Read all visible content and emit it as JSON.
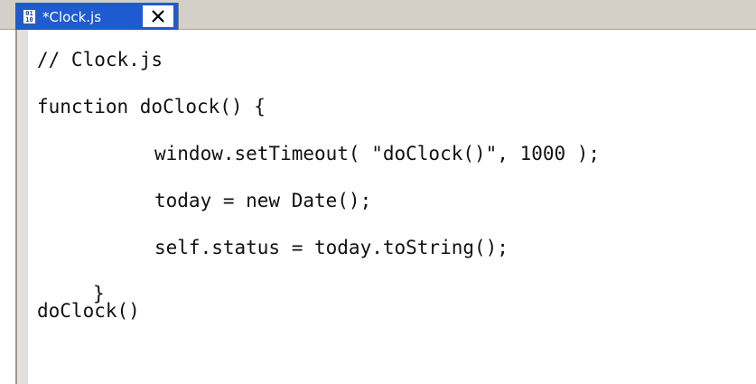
{
  "tab": {
    "icon": "js-file-icon",
    "title": "*Clock.js",
    "close_icon": "close-icon"
  },
  "editor": {
    "lines": [
      "// Clock.js",
      "function doClock() {",
      "window.setTimeout( \"doClock()\", 1000 );",
      "today = new Date();",
      "self.status = today.toString();",
      "}",
      "doClock()"
    ]
  },
  "colors": {
    "tab_active_bg": "#1f5bd0",
    "tabbar_bg": "#d4d0c8",
    "editor_bg": "#ffffff",
    "text": "#111111"
  }
}
